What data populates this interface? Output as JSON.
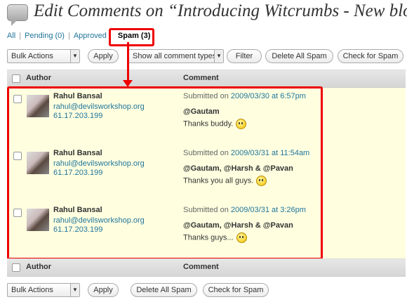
{
  "page": {
    "title": "Edit Comments on “Introducing Witcrumbs - New blog",
    "icon": "comments-icon"
  },
  "filters": {
    "all": "All",
    "pending": "Pending (0)",
    "approved": "Approved",
    "spam": "Spam (3)"
  },
  "top_actions": {
    "bulk_actions": "Bulk Actions",
    "apply": "Apply",
    "comment_types": "Show all comment types",
    "filter": "Filter",
    "delete_all_spam": "Delete All Spam",
    "check_for_spam": "Check for Spam"
  },
  "table": {
    "col_author": "Author",
    "col_comment": "Comment"
  },
  "comments": [
    {
      "author": "Rahul Bansal",
      "email": "rahul@devilsworkshop.org",
      "ip": "61.17.203.199",
      "submitted_prefix": "Submitted on",
      "date": "2009/03/30 at 6:57pm",
      "mentions": "@Gautam",
      "text": "Thanks buddy."
    },
    {
      "author": "Rahul Bansal",
      "email": "rahul@devilsworkshop.org",
      "ip": "61.17.203.199",
      "submitted_prefix": "Submitted on",
      "date": "2009/03/31 at 11:54am",
      "mentions": "@Gautam, @Harsh & @Pavan",
      "text": "Thanks you all guys."
    },
    {
      "author": "Rahul Bansal",
      "email": "rahul@devilsworkshop.org",
      "ip": "61.17.203.199",
      "submitted_prefix": "Submitted on",
      "date": "2009/03/31 at 3:26pm",
      "mentions": "@Gautam, @Harsh & @Pavan",
      "text": "Thanks guys..."
    }
  ],
  "bottom_actions": {
    "bulk_actions": "Bulk Actions",
    "apply": "Apply",
    "delete_all_spam": "Delete All Spam",
    "check_for_spam": "Check for Spam"
  },
  "colors": {
    "highlight": "#e00000",
    "link": "#21759b",
    "spam_row_bg": "#ffffe0"
  }
}
